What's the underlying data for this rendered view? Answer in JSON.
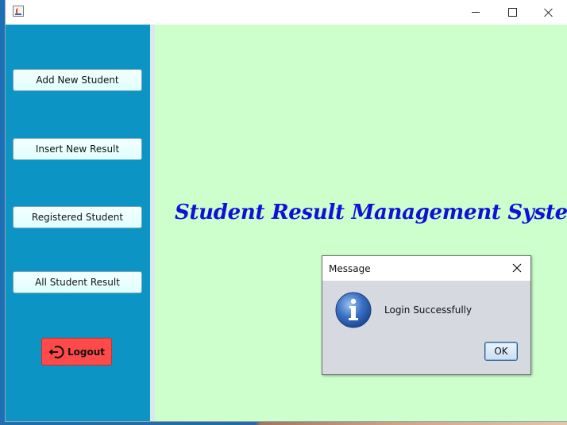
{
  "window": {
    "title": ""
  },
  "sidebar": {
    "buttons": [
      {
        "label": "Add New Student"
      },
      {
        "label": "Insert New Result"
      },
      {
        "label": "Registered Student"
      },
      {
        "label": "All Student Result"
      }
    ],
    "logout": {
      "label": "Logout",
      "icon": "logout-icon",
      "color": "#ff4a4a"
    }
  },
  "main": {
    "title": "Student Result Management System",
    "title_color": "#1010d8",
    "background": "#ccffcc"
  },
  "dialog": {
    "title": "Message",
    "message": "Login Successfully",
    "icon": "info-icon",
    "ok_label": "OK"
  },
  "colors": {
    "sidebar": "#0b94c4",
    "side_button": "#e0ffff"
  }
}
